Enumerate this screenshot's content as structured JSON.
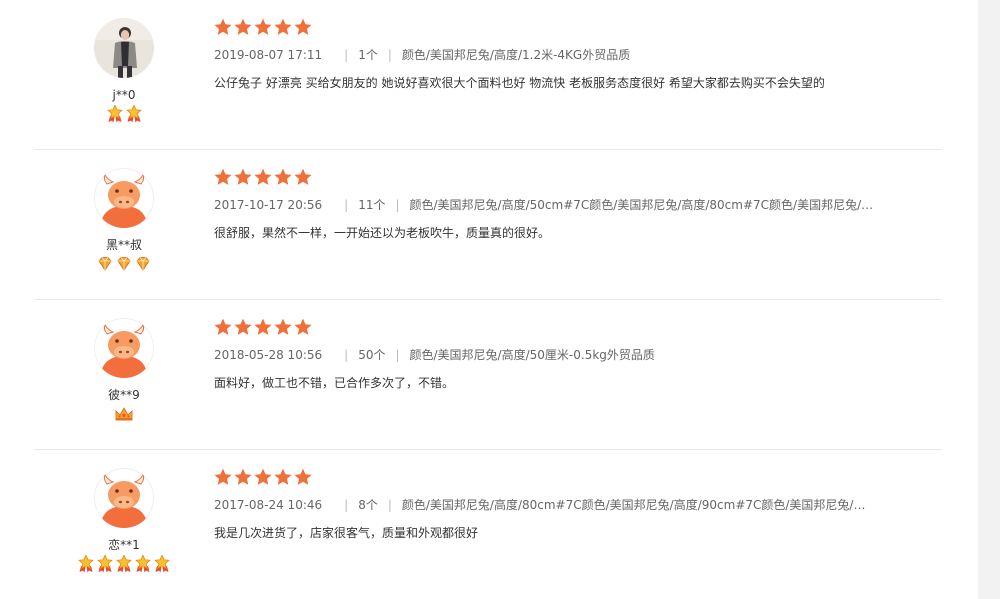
{
  "reviews": [
    {
      "avatar": "photo-avatar",
      "user_name": "j**0",
      "badge_type": "star-medal",
      "badge_count": 2,
      "rating": 5,
      "date": "2019-08-07 17:11",
      "quantity": "1个",
      "sku": "颜色/美国邦尼兔/高度/1.2米-4KG外贸品质",
      "comment": "公仔兔子 好漂亮 买给女朋友的 她说好喜欢很大个面料也好 物流快 老板服务态度很好 希望大家都去购买不会失望的"
    },
    {
      "avatar": "bull-avatar",
      "user_name": "黑**叔",
      "badge_type": "diamond",
      "badge_count": 3,
      "rating": 5,
      "date": "2017-10-17 20:56",
      "quantity": "11个",
      "sku": "颜色/美国邦尼兔/高度/50cm#7C颜色/美国邦尼兔/高度/80cm#7C颜色/美国邦尼兔/高度...",
      "comment": "很舒服，果然不一样，一开始还以为老板吹牛，质量真的很好。"
    },
    {
      "avatar": "bull-avatar",
      "user_name": "彼**9",
      "badge_type": "crown",
      "badge_count": 1,
      "rating": 5,
      "date": "2018-05-28 10:56",
      "quantity": "50个",
      "sku": "颜色/美国邦尼兔/高度/50厘米-0.5kg外贸品质",
      "comment": "面料好，做工也不错，已合作多次了，不错。"
    },
    {
      "avatar": "bull-avatar",
      "user_name": "恋**1",
      "badge_type": "star-medal",
      "badge_count": 5,
      "rating": 5,
      "date": "2017-08-24 10:46",
      "quantity": "8个",
      "sku": "颜色/美国邦尼兔/高度/80cm#7C颜色/美国邦尼兔/高度/90cm#7C颜色/美国邦尼兔/高度...",
      "comment": "我是几次进货了，店家很客气，质量和外观都很好"
    }
  ],
  "separator": "|",
  "colors": {
    "star": "#f0703a",
    "bull_face": "#f79b62",
    "bull_body": "#f26e3c",
    "divider": "#e8e8e8",
    "gutter": "#f2f2f2"
  }
}
